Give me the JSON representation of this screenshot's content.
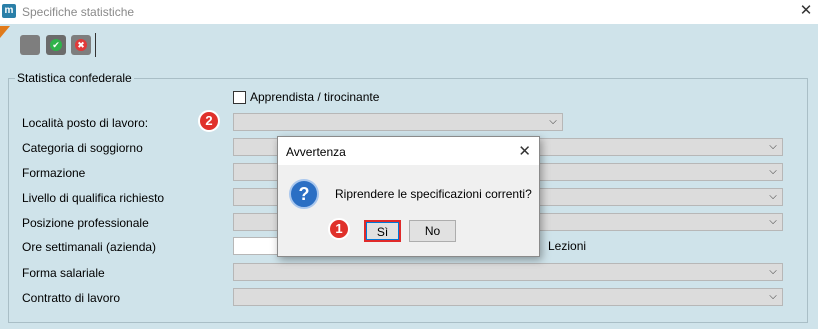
{
  "window": {
    "app_icon_glyph": "m",
    "title": "Specifiche statistiche",
    "close_glyph": "✕"
  },
  "toolbar": {
    "buttons": [
      {
        "name": "disabled-button",
        "icon": "blank-icon"
      },
      {
        "name": "confirm-button",
        "icon": "check-icon",
        "glyph": "✔"
      },
      {
        "name": "cancel-button",
        "icon": "cross-icon",
        "glyph": "✖"
      }
    ]
  },
  "form": {
    "group_title": "Statistica confederale",
    "checkbox_label": "Apprendista / tirocinante",
    "fields": {
      "localita": "Località posto di lavoro:",
      "categoria": "Categoria di soggiorno",
      "formazione": "Formazione",
      "livello": "Livello di qualifica richiesto",
      "posizione": "Posizione professionale",
      "ore": "Ore settimanali (azienda)",
      "forma": "Forma salariale",
      "contratto": "Contratto di lavoro"
    },
    "lezioni_label": "Lezioni",
    "dropdown_arrow": "⌵"
  },
  "annotations": {
    "badge_1": "1",
    "badge_2": "2",
    "badge_color": "#e0312b"
  },
  "dialog": {
    "title": "Avvertenza",
    "close_glyph": "✕",
    "icon_glyph": "?",
    "message": "Riprendere le specificazioni correnti?",
    "yes_label": "Sì",
    "no_label": "No"
  }
}
